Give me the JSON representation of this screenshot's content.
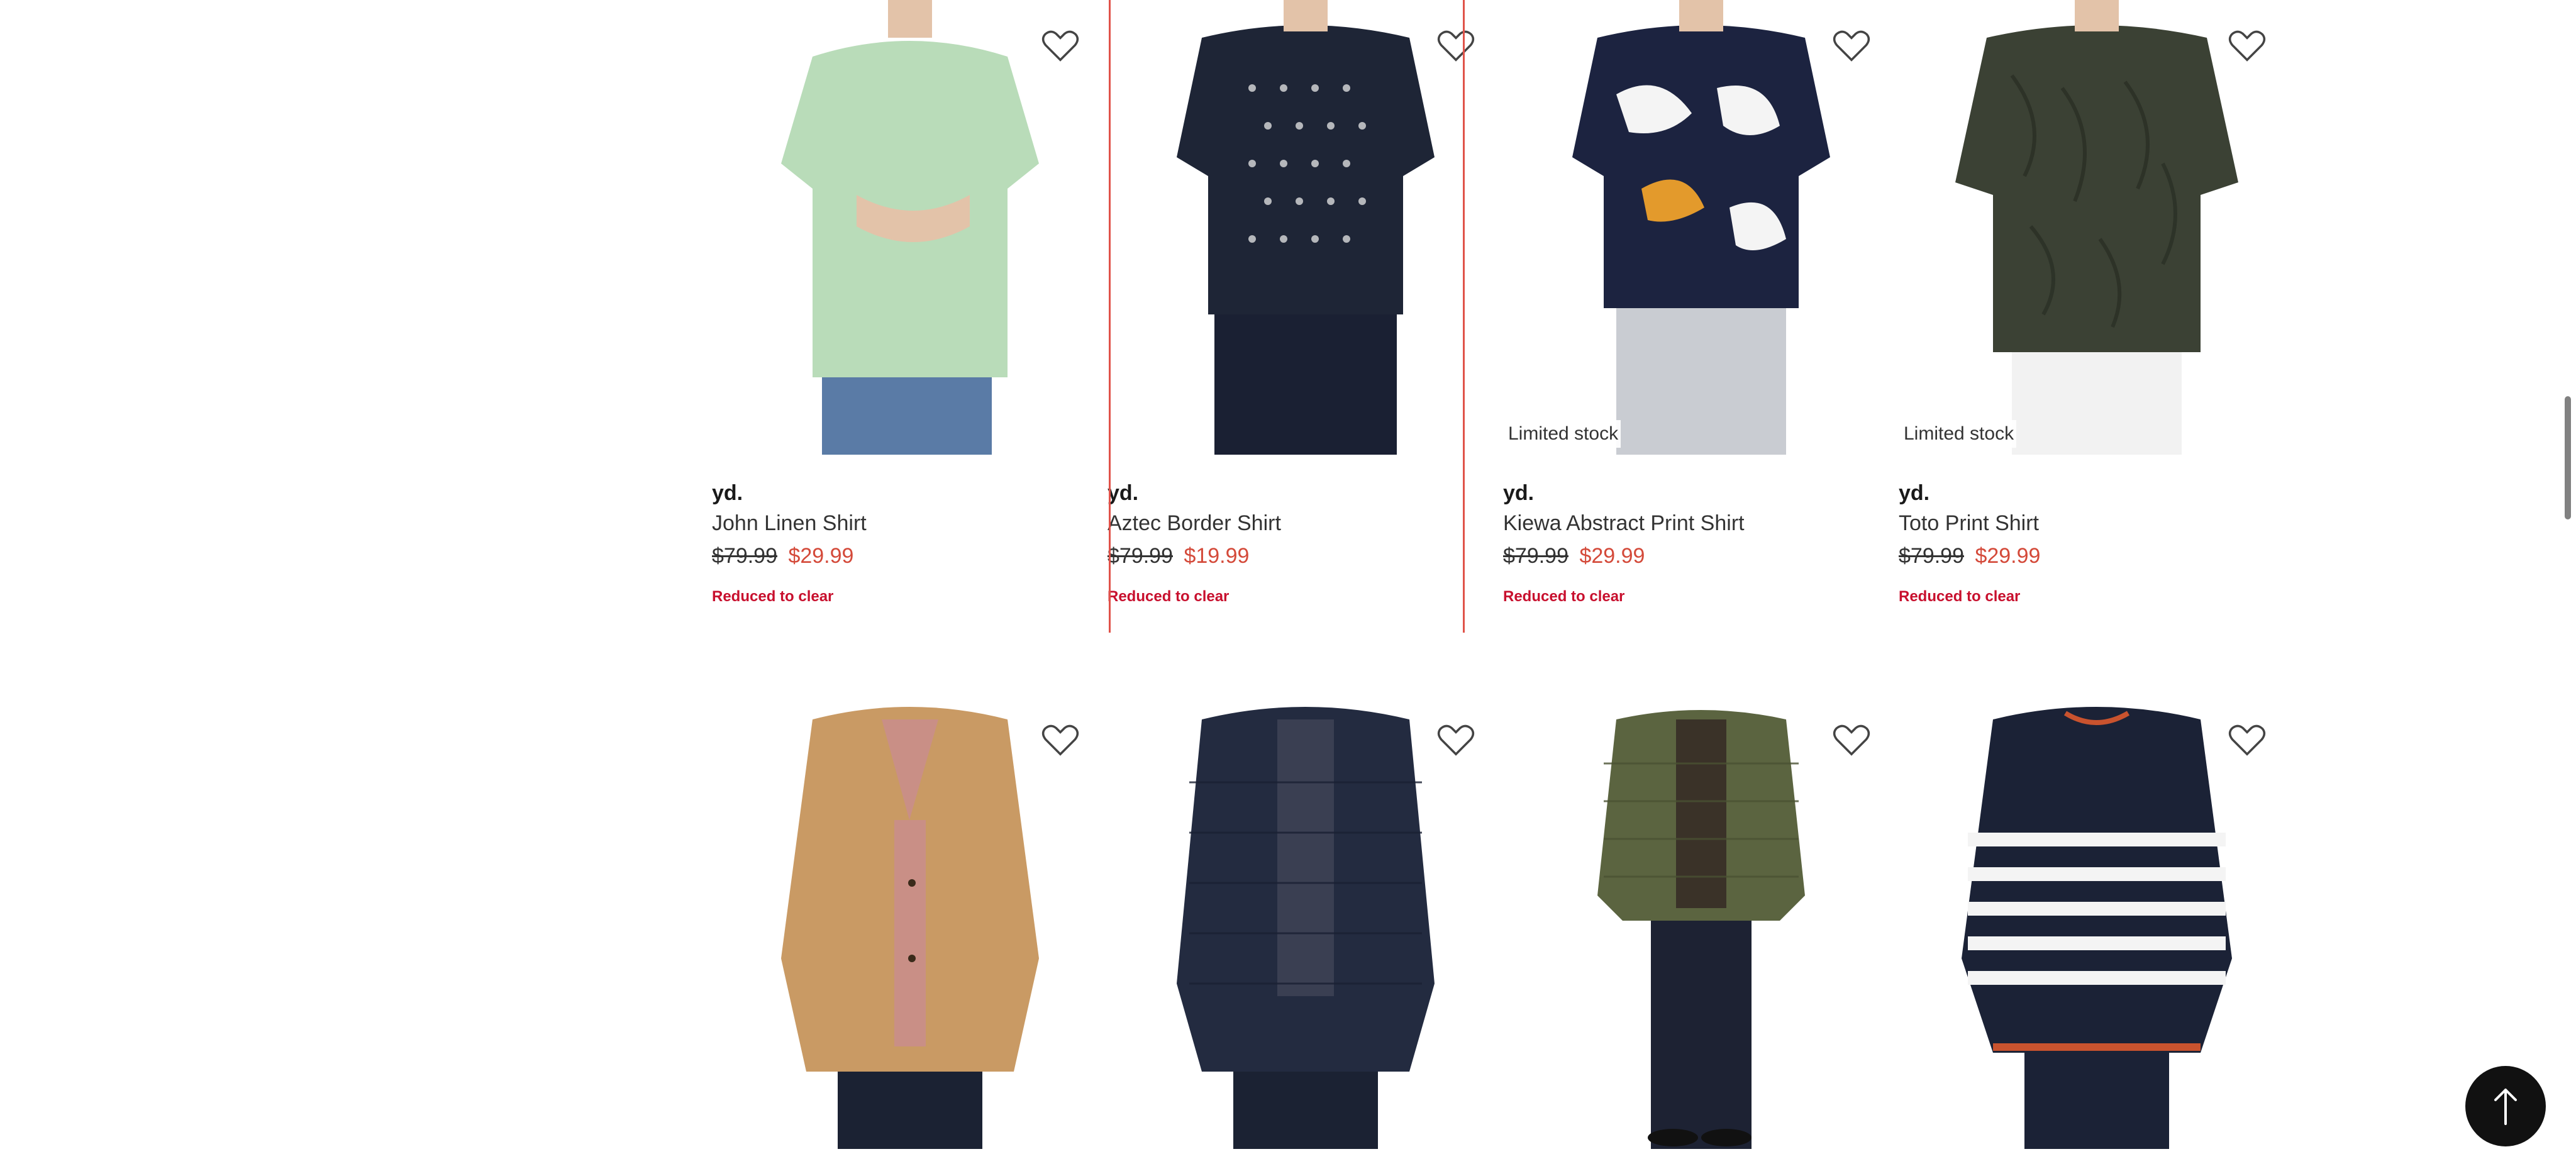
{
  "products": [
    {
      "brand": "yd.",
      "name": "John Linen Shirt",
      "was_price": "$79.99",
      "now_price": "$29.99",
      "promo": "Reduced to clear",
      "badge": "",
      "wishlist_icon": "heart-outline-icon",
      "garment_color": "#b9dcb9",
      "pants_color": "#5a7ba6"
    },
    {
      "brand": "yd.",
      "name": "Aztec Border Shirt",
      "was_price": "$79.99",
      "now_price": "$19.99",
      "promo": "Reduced to clear",
      "badge": "",
      "wishlist_icon": "heart-outline-icon",
      "garment_color": "#1e2536",
      "pants_color": "#1a2033"
    },
    {
      "brand": "yd.",
      "name": "Kiewa Abstract Print Shirt",
      "was_price": "$79.99",
      "now_price": "$29.99",
      "promo": "Reduced to clear",
      "badge": "Limited stock",
      "wishlist_icon": "heart-outline-icon",
      "garment_color": "#1c2340",
      "pants_color": "#c9ccd2"
    },
    {
      "brand": "yd.",
      "name": "Toto Print Shirt",
      "was_price": "$79.99",
      "now_price": "$29.99",
      "promo": "Reduced to clear",
      "badge": "Limited stock",
      "wishlist_icon": "heart-outline-icon",
      "garment_color": "#3b4134",
      "pants_color": "#f2f2f2"
    },
    {
      "wishlist_icon": "heart-outline-icon",
      "garment_color": "#c99a64",
      "pants_color": "#1b2233"
    },
    {
      "wishlist_icon": "heart-outline-icon",
      "garment_color": "#232b40",
      "pants_color": "#1b2233"
    },
    {
      "wishlist_icon": "heart-outline-icon",
      "garment_color": "#5b6440",
      "pants_color": "#1d2233"
    },
    {
      "wishlist_icon": "heart-outline-icon",
      "garment_color": "#1b2236",
      "pants_color": "#1b2236"
    }
  ],
  "back_to_top": {
    "icon": "arrow-up-icon"
  },
  "colors": {
    "sale_price": "#d44a3a",
    "promo_text": "#c8102e",
    "focus_outline": "#e0534a"
  }
}
